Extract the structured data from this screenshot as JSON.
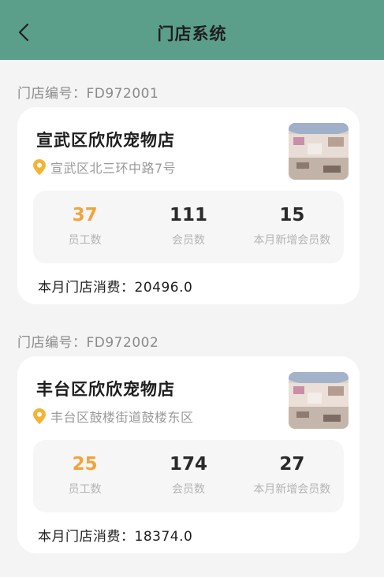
{
  "header": {
    "title": "门店系统"
  },
  "stores": [
    {
      "code_label": "门店编号：FD972001",
      "name": "宣武区欣欣宠物店",
      "address": "宣武区北三环中路7号",
      "stats": [
        {
          "value": "37",
          "label": "员工数"
        },
        {
          "value": "111",
          "label": "会员数"
        },
        {
          "value": "15",
          "label": "本月新增会员数"
        }
      ],
      "consumption": "本月门店消费：20496.0"
    },
    {
      "code_label": "门店编号：FD972002",
      "name": "丰台区欣欣宠物店",
      "address": "丰台区鼓楼街道鼓楼东区",
      "stats": [
        {
          "value": "25",
          "label": "员工数"
        },
        {
          "value": "174",
          "label": "会员数"
        },
        {
          "value": "27",
          "label": "本月新增会员数"
        }
      ],
      "consumption": "本月门店消费：18374.0"
    }
  ],
  "colors": {
    "header_bg": "#5b9e8a",
    "accent_orange": "#f0a43c",
    "pin_orange": "#f5b335",
    "page_bg": "#f4f4f4"
  },
  "icons": {
    "back": "chevron-left-icon",
    "location": "location-pin-icon"
  }
}
